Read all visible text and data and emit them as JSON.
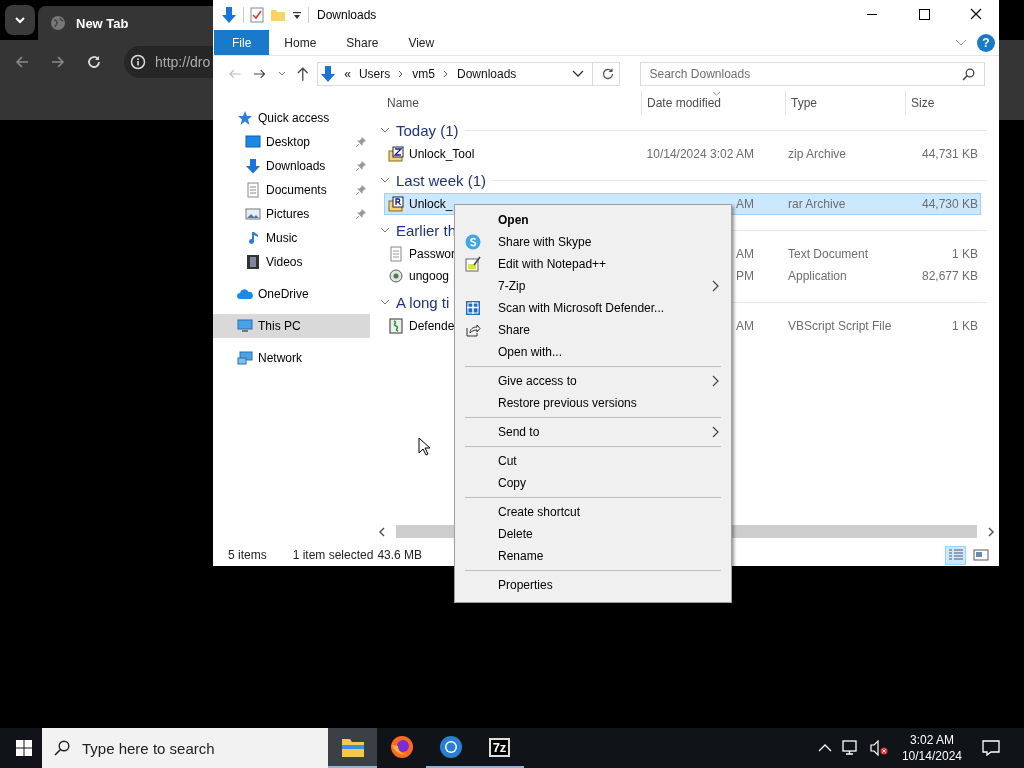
{
  "browser": {
    "tab": {
      "title": "New Tab"
    },
    "address": {
      "value": "http://dro"
    }
  },
  "explorer": {
    "title": "Downloads",
    "ribbon_tabs": [
      {
        "label": "File",
        "selected": true
      },
      {
        "label": "Home",
        "selected": false
      },
      {
        "label": "Share",
        "selected": false
      },
      {
        "label": "View",
        "selected": false
      }
    ],
    "help": "?",
    "address": {
      "prefix": "«",
      "crumbs": [
        "Users",
        "vm5",
        "Downloads"
      ]
    },
    "search": {
      "placeholder": "Search Downloads"
    },
    "sidebar": [
      {
        "label": "Quick access",
        "kind": "star",
        "selected": false,
        "children": [
          {
            "label": "Desktop",
            "kind": "desktop",
            "pinned": true,
            "selected": false
          },
          {
            "label": "Downloads",
            "kind": "downloads",
            "pinned": true,
            "selected": false
          },
          {
            "label": "Documents",
            "kind": "documents",
            "pinned": true,
            "selected": false
          },
          {
            "label": "Pictures",
            "kind": "pictures",
            "pinned": true,
            "selected": false
          },
          {
            "label": "Music",
            "kind": "music",
            "pinned": false,
            "selected": false
          },
          {
            "label": "Videos",
            "kind": "videos",
            "pinned": false,
            "selected": false
          }
        ]
      },
      {
        "label": "OneDrive",
        "kind": "onedrive",
        "selected": false
      },
      {
        "label": "This PC",
        "kind": "pc",
        "selected": true
      },
      {
        "label": "Network",
        "kind": "network",
        "selected": false
      }
    ],
    "columns": [
      "Name",
      "Date modified",
      "Type",
      "Size"
    ],
    "groups": [
      {
        "title": "Today (1)",
        "expanded": true,
        "rows": [
          {
            "name": "Unlock_Tool",
            "kind": "zip",
            "date": "10/14/2024 3:02 AM",
            "type": "zip Archive",
            "size": "44,731 KB",
            "selected": false
          }
        ]
      },
      {
        "title": "Last week (1)",
        "expanded": true,
        "rows": [
          {
            "name": "Unlock_",
            "kind": "rar",
            "date": "AM",
            "type": "rar Archive",
            "size": "44,730 KB",
            "selected": true
          }
        ]
      },
      {
        "title": "Earlier th",
        "expanded": true,
        "rows": [
          {
            "name": "Passwor",
            "kind": "text",
            "date": "AM",
            "type": "Text Document",
            "size": "1 KB",
            "selected": false
          },
          {
            "name": "ungoog",
            "kind": "app",
            "date": "PM",
            "type": "Application",
            "size": "82,677 KB",
            "selected": false
          }
        ]
      },
      {
        "title": "A long ti",
        "expanded": true,
        "rows": [
          {
            "name": "Defende",
            "kind": "script",
            "date": "AM",
            "type": "VBScript Script File",
            "size": "1 KB",
            "selected": false
          }
        ]
      }
    ],
    "status": {
      "count": "5 items",
      "selection": "1 item selected",
      "size": "43.6 MB"
    },
    "views": [
      {
        "kind": "details",
        "selected": true
      },
      {
        "kind": "tiles",
        "selected": false
      }
    ]
  },
  "context_menu": [
    {
      "kind": "item",
      "label": "Open",
      "default": true,
      "submenu": false
    },
    {
      "kind": "item",
      "label": "Share with Skype",
      "default": false,
      "submenu": false
    },
    {
      "kind": "item",
      "label": "Edit with Notepad++",
      "default": false,
      "submenu": false
    },
    {
      "kind": "item",
      "label": "7-Zip",
      "default": false,
      "submenu": true
    },
    {
      "kind": "item",
      "label": "Scan with Microsoft Defender...",
      "default": false,
      "submenu": false
    },
    {
      "kind": "item",
      "label": "Share",
      "default": false,
      "submenu": false
    },
    {
      "kind": "item",
      "label": "Open with...",
      "default": false,
      "submenu": false
    },
    {
      "kind": "separator"
    },
    {
      "kind": "item",
      "label": "Give access to",
      "default": false,
      "submenu": true
    },
    {
      "kind": "item",
      "label": "Restore previous versions",
      "default": false,
      "submenu": false
    },
    {
      "kind": "separator"
    },
    {
      "kind": "item",
      "label": "Send to",
      "default": false,
      "submenu": true
    },
    {
      "kind": "separator"
    },
    {
      "kind": "item",
      "label": "Cut",
      "default": false,
      "submenu": false
    },
    {
      "kind": "item",
      "label": "Copy",
      "default": false,
      "submenu": false
    },
    {
      "kind": "separator"
    },
    {
      "kind": "item",
      "label": "Create shortcut",
      "default": false,
      "submenu": false
    },
    {
      "kind": "item",
      "label": "Delete",
      "default": false,
      "submenu": false
    },
    {
      "kind": "item",
      "label": "Rename",
      "default": false,
      "submenu": false
    },
    {
      "kind": "separator"
    },
    {
      "kind": "item",
      "label": "Properties",
      "default": false,
      "submenu": false
    }
  ],
  "taskbar": {
    "search": {
      "placeholder": "Type here to search"
    },
    "apps": [
      {
        "kind": "explorer",
        "active": true,
        "running": true
      },
      {
        "kind": "firefox",
        "active": false,
        "running": false
      },
      {
        "kind": "chrome",
        "active": false,
        "running": true
      },
      {
        "kind": "archiver",
        "label": "7z",
        "active": false,
        "running": true
      }
    ],
    "clock": {
      "time": "3:02 AM",
      "date": "10/14/2024"
    }
  }
}
